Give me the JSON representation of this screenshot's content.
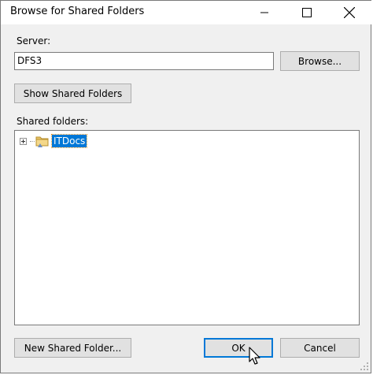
{
  "window": {
    "title": "Browse for Shared Folders",
    "minimize_icon": "minimize-icon",
    "maximize_icon": "maximize-icon",
    "close_icon": "close-icon"
  },
  "server": {
    "label": "Server:",
    "value": "DFS3",
    "browse_label": "Browse..."
  },
  "show_shared_folders_label": "Show Shared Folders",
  "shared_folders": {
    "label": "Shared folders:",
    "items": [
      {
        "name": "ITDocs",
        "selected": true,
        "expandable": true,
        "icon": "shared-folder-icon"
      }
    ]
  },
  "footer": {
    "new_folder_label": "New Shared Folder...",
    "ok_label": "OK",
    "cancel_label": "Cancel"
  },
  "colors": {
    "selection": "#0078d7",
    "default_button_border": "#0078d7",
    "dialog_bg": "#f0f0f0"
  }
}
